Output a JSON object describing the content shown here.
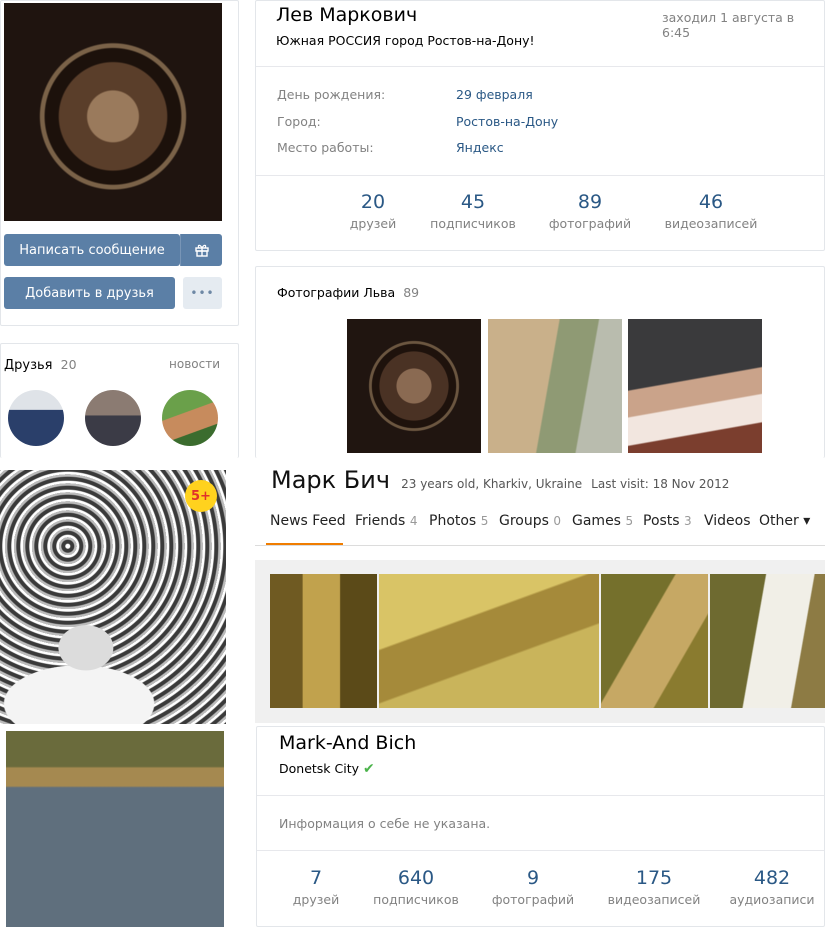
{
  "profile1": {
    "name": "Лев Маркович",
    "last_seen": "заходил 1 августа в 6:45",
    "status": "Южная РОССИЯ город Ростов-на-Дону!",
    "info": [
      {
        "label": "День рождения:",
        "value": "29 февраля"
      },
      {
        "label": "Город:",
        "value": "Ростов-на-Дону"
      },
      {
        "label": "Место работы:",
        "value": "Яндекс"
      }
    ],
    "counters": [
      {
        "num": "20",
        "label": "друзей"
      },
      {
        "num": "45",
        "label": "подписчиков"
      },
      {
        "num": "89",
        "label": "фотографий"
      },
      {
        "num": "46",
        "label": "видеозаписей"
      }
    ],
    "buttons": {
      "message": "Написать сообщение",
      "add_friend": "Добавить в друзья",
      "more": "•••"
    },
    "icons": {
      "gift": "gift-icon",
      "more": "more-icon"
    },
    "photos_block": {
      "title": "Фотографии Льва",
      "count": "89"
    },
    "friends_block": {
      "title": "Друзья",
      "count": "20",
      "news_link": "новости"
    }
  },
  "profile2": {
    "name": "Марк Бич",
    "meta": "23 years old, Kharkiv, Ukraine",
    "last_visit": "Last visit: 18 Nov 2012",
    "badge": "5+",
    "tabs": [
      {
        "label": "News Feed",
        "count": ""
      },
      {
        "label": "Friends",
        "count": "4"
      },
      {
        "label": "Photos",
        "count": "5"
      },
      {
        "label": "Groups",
        "count": "0"
      },
      {
        "label": "Games",
        "count": "5"
      },
      {
        "label": "Posts",
        "count": "3"
      },
      {
        "label": "Videos",
        "count": ""
      },
      {
        "label": "Other ▾",
        "count": ""
      }
    ],
    "active_tab_color": "#f07d00"
  },
  "profile3": {
    "name": "Mark-And Bich",
    "city": "Donetsk City",
    "check": "✔",
    "about": "Информация о себе не указана.",
    "counters": [
      {
        "num": "7",
        "label": "друзей"
      },
      {
        "num": "640",
        "label": "подписчиков"
      },
      {
        "num": "9",
        "label": "фотографий"
      },
      {
        "num": "175",
        "label": "видеозаписей"
      },
      {
        "num": "482",
        "label": "аудиозаписи"
      }
    ]
  },
  "colors": {
    "link": "#2a5885",
    "button": "#5b7fa6",
    "muted": "#828282",
    "check": "#4bb34b"
  }
}
